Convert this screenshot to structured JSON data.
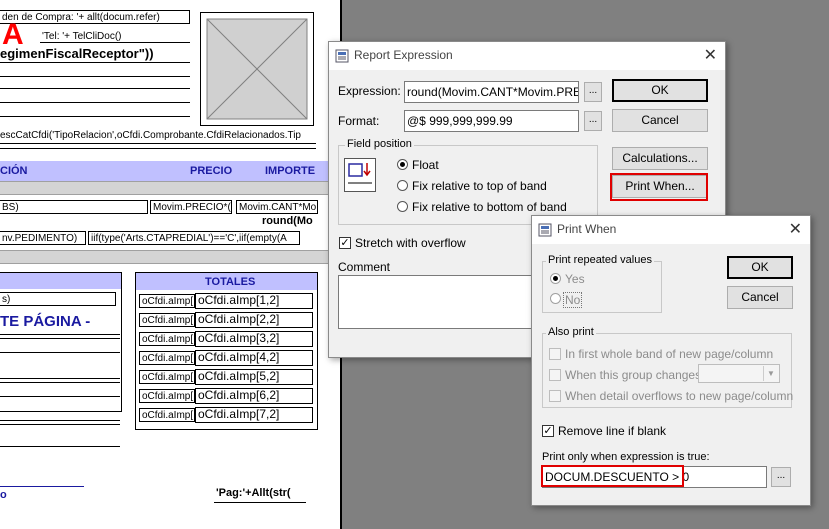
{
  "report": {
    "hdr_compra": "den de Compra: '+ allt(docum.refer)",
    "big_letter": "A",
    "tel": "'Tel: '+ TelCliDoc()",
    "regimen": "egimenFiscalReceptor\"))",
    "cfdi_rel": "escCatCfdi('TipoRelacion',oCfdi.Comprobante.CfdiRelacionados.Tip",
    "band_cols": [
      "CIÓN",
      "PRECIO",
      "IMPORTE"
    ],
    "det_1": "BS)",
    "det_precio": "Movim.PRECIO*(",
    "det_cant": "Movim.CANT*Mo",
    "det_round": "round(Mo",
    "det_ped": "nv.PEDIMENTO)",
    "det_iif": "iif(type('Arts.CTAPREDIAL')=='C',iif(empty(A",
    "det_s": "s)",
    "totales": "TOTALES",
    "pagina": "TE PÁGINA -",
    "imp_labels": [
      "oCfdi.aImp[",
      "oCfdi.aImp[",
      "oCfdi.aImp[",
      "oCfdi.aImp[",
      "oCfdi.aImp[",
      "oCfdi.aImp[",
      "oCfdi.aImp["
    ],
    "imp_vals": [
      "oCfdi.aImp[1,2]",
      "oCfdi.aImp[2,2]",
      "oCfdi.aImp[3,2]",
      "oCfdi.aImp[4,2]",
      "oCfdi.aImp[5,2]",
      "oCfdi.aImp[6,2]",
      "oCfdi.aImp[7,2]"
    ],
    "footer_o": "o",
    "pag": "'Pag:'+Allt(str("
  },
  "report_expression": {
    "title": "Report Expression",
    "expression_label": "Expression:",
    "expression_value": "round(Movim.CANT*Movim.PRECIO",
    "format_label": "Format:",
    "format_value": "@$ 999,999,999.99",
    "ok": "OK",
    "cancel": "Cancel",
    "calculations": "Calculations...",
    "print_when": "Print When...",
    "field_position": "Field position",
    "float": "Float",
    "fix_top": "Fix relative to top of band",
    "fix_bottom": "Fix relative to bottom of band",
    "stretch": "Stretch with overflow",
    "comment": "Comment"
  },
  "print_when": {
    "title": "Print When",
    "repeated_group": "Print repeated values",
    "yes": "Yes",
    "no": "No",
    "ok": "OK",
    "cancel": "Cancel",
    "also_print": "Also print",
    "first_whole": "In first whole band of new page/column",
    "group_changes": "When this group changes",
    "detail_overflows": "When detail overflows to new page/column",
    "remove_blank": "Remove line if blank",
    "expr_label": "Print only when expression is true:",
    "expr_value": "DOCUM.DESCUENTO > 0"
  },
  "colors": {
    "band": "#c0c0ff",
    "highlight": "#e00000",
    "big_letter": "#ff0000",
    "blue_text": "#1a1aa0"
  }
}
